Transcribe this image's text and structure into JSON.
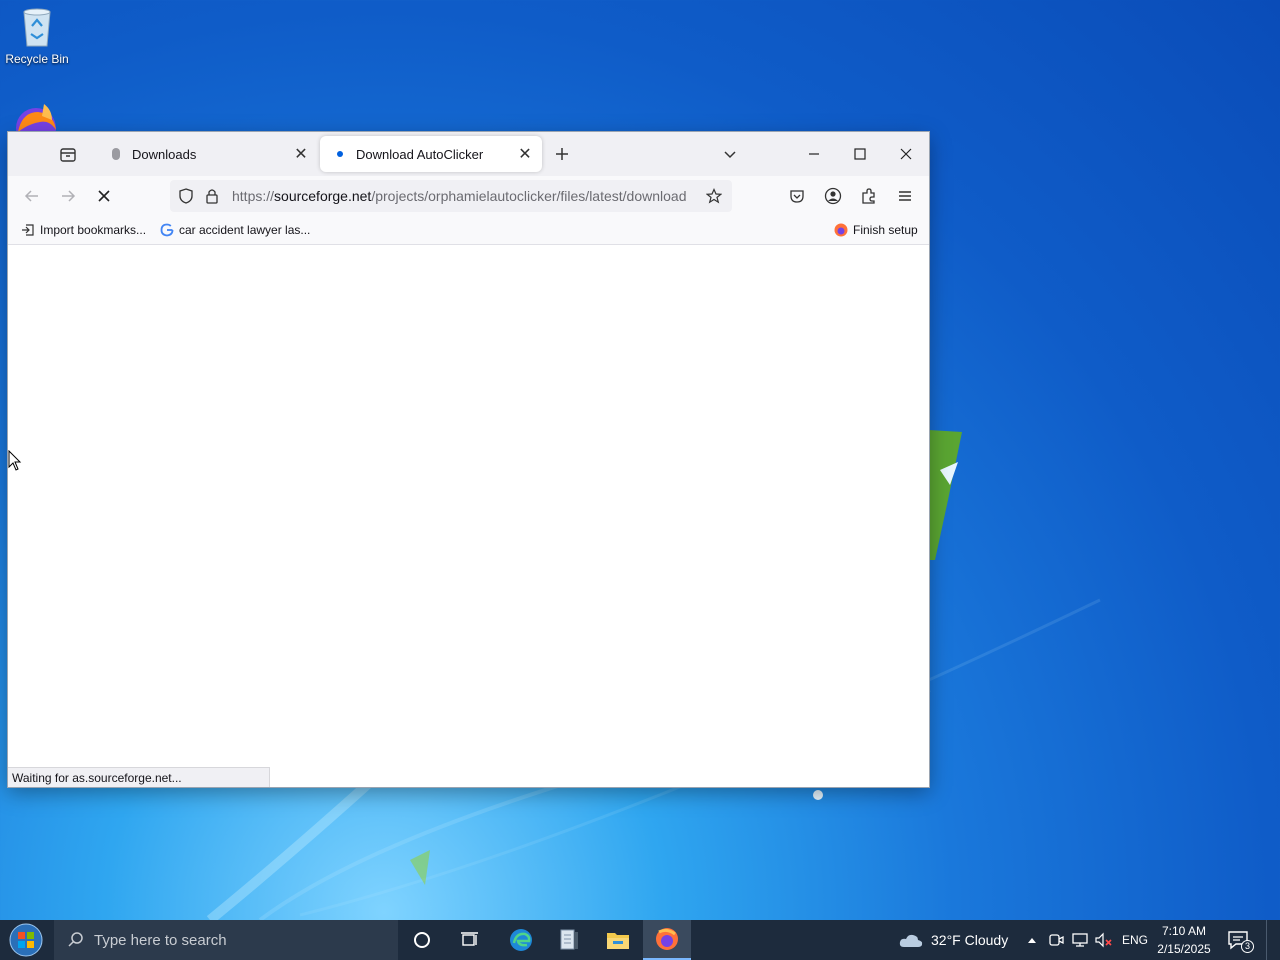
{
  "desktop": {
    "recycle_bin_label": "Recycle Bin"
  },
  "browser": {
    "tabs": [
      {
        "title": "Downloads",
        "active": false
      },
      {
        "title": "Download AutoClicker",
        "active": true
      }
    ],
    "url": {
      "scheme": "https://",
      "host": "sourceforge.net",
      "path": "/projects/orphamielautoclicker/files/latest/download"
    },
    "bookmarks": {
      "import": "Import bookmarks...",
      "google_item": "car accident lawyer las...",
      "finish_setup": "Finish setup"
    },
    "status_text": "Waiting for as.sourceforge.net..."
  },
  "taskbar": {
    "search_placeholder": "Type here to search",
    "weather": "32°F  Cloudy",
    "language": "ENG",
    "time": "7:10 AM",
    "date": "2/15/2025",
    "notification_count": "3"
  },
  "colors": {
    "taskbar_bg": "#1d2b3d",
    "tab_strip_bg": "#f0f0f4",
    "accent": "#0060df"
  }
}
